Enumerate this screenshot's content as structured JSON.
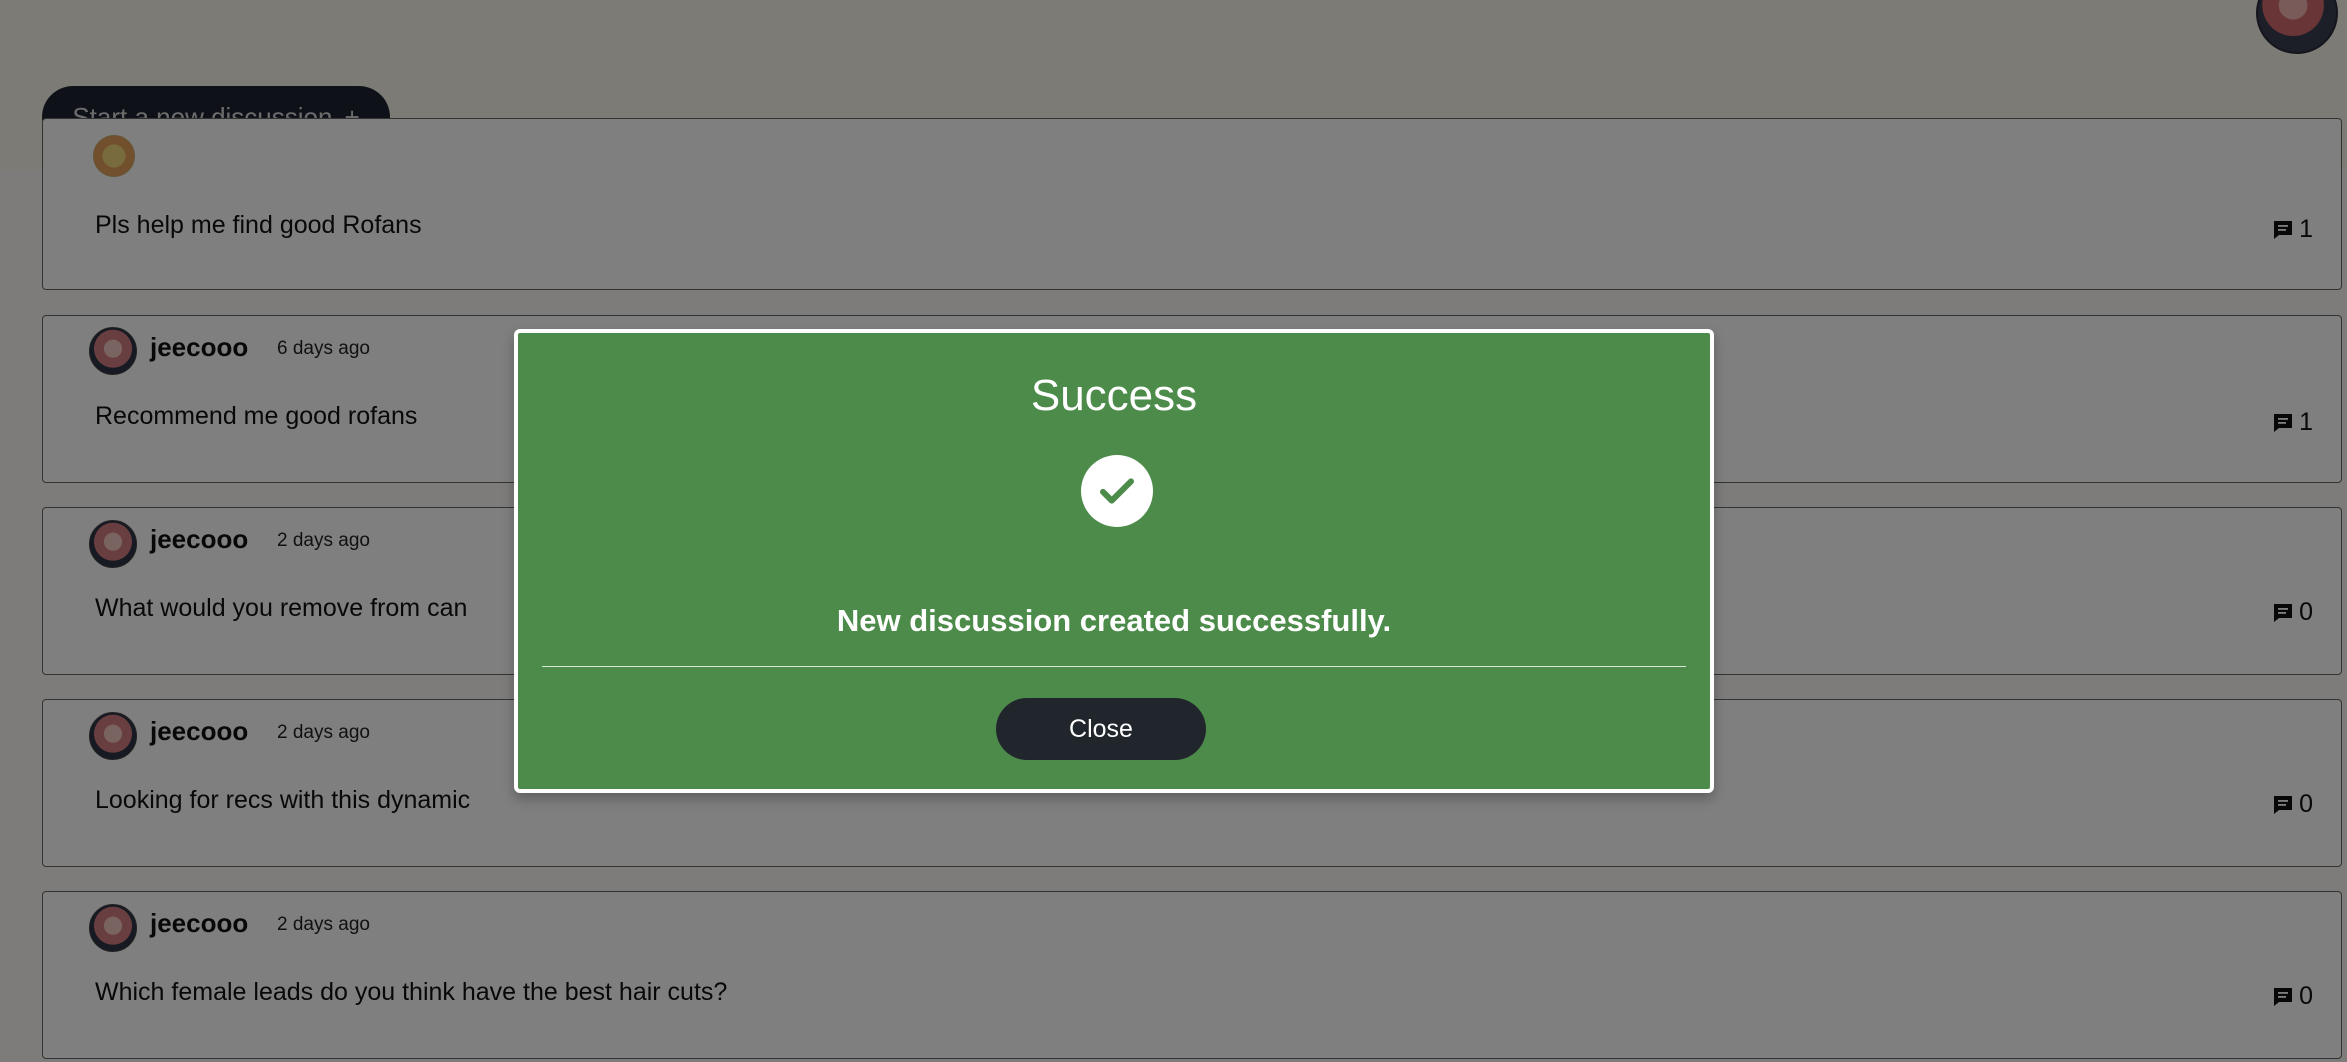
{
  "header": {
    "new_discussion_label": "Start a new discussion",
    "new_discussion_icon": "+"
  },
  "discussions": [
    {
      "author": "",
      "time": "",
      "title": "Pls help me find good Rofans",
      "comments": "1"
    },
    {
      "author": "jeecooo",
      "time": "6 days ago",
      "title": "Recommend me good rofans",
      "comments": "1"
    },
    {
      "author": "jeecooo",
      "time": "2 days ago",
      "title": "What would you remove from can",
      "comments": "0"
    },
    {
      "author": "jeecooo",
      "time": "2 days ago",
      "title": "Looking for recs with this dynamic",
      "comments": "0"
    },
    {
      "author": "jeecooo",
      "time": "2 days ago",
      "title": "Which female leads do you think have the best hair cuts?",
      "comments": "0"
    }
  ],
  "modal": {
    "title": "Success",
    "message": "New discussion created successfully.",
    "close_label": "Close",
    "icon": "check-icon"
  },
  "colors": {
    "modal_background": "#4c8b4a",
    "button_dark": "#1d2430",
    "overlay": "rgba(0,0,0,0.5)"
  }
}
